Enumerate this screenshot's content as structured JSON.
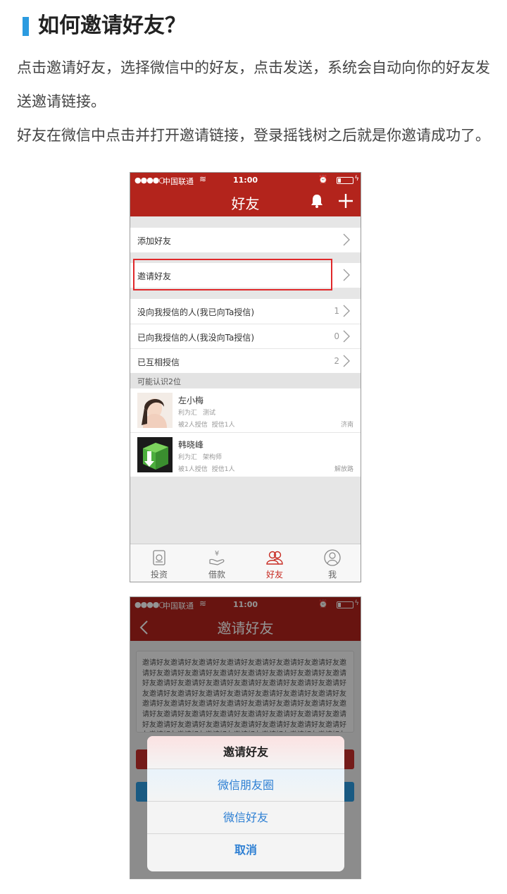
{
  "article": {
    "title": "如何邀请好友？",
    "para1": "点击邀请好友，选择微信中的好友，点击发送，系统会自动向你的好友发送邀请链接。",
    "para2": "好友在微信中点击并打开邀请链接，登录摇钱树之后就是你邀请成功了。"
  },
  "status_bar": {
    "signal": "●●●●○",
    "carrier": "中国联通",
    "time": "11:00"
  },
  "friends_screen": {
    "nav_title": "好友",
    "add_friend": "添加好友",
    "invite_friend": "邀请好友",
    "rows": [
      {
        "label": "没向我授信的人(我已向Ta授信)",
        "count": "1"
      },
      {
        "label": "已向我授信的人(我没向Ta授信)",
        "count": "0"
      },
      {
        "label": "已互相授信",
        "count": "2"
      }
    ],
    "section_header": "可能认识2位",
    "people": [
      {
        "name": "左小梅",
        "company": "利为汇",
        "role": "测试",
        "trusted_by": "被2人授信",
        "trusts": "授信1人",
        "location": "济南"
      },
      {
        "name": "韩晓峰",
        "company": "利为汇",
        "role": "架构师",
        "trusted_by": "被1人授信",
        "trusts": "授信1人",
        "location": "解放路"
      }
    ],
    "tabs": [
      {
        "label": "投资",
        "icon": "invest-icon"
      },
      {
        "label": "借款",
        "icon": "loan-icon"
      },
      {
        "label": "好友",
        "icon": "friends-icon"
      },
      {
        "label": "我",
        "icon": "me-icon"
      }
    ],
    "active_tab": "好友"
  },
  "invite_screen": {
    "nav_title": "邀请好友",
    "placeholder_text": "邀请好友邀请好友邀请好友邀请好友邀请好友邀请好友邀请好友邀请好友邀请好友邀请好友邀请好友邀请好友邀请好友邀请好友邀请好友邀请好友邀请好友邀请好友邀请好友邀请好友邀请好友邀请好友邀请好友邀请好友邀请好友邀请好友邀请好友邀请好友邀请好友邀请好友邀请好友邀请好友邀请好友邀请好友邀请好友邀请好友邀请好友邀请好友邀请好友邀请好友邀请好友邀请好友邀请好友邀请好友邀请好友邀请好友邀请好友邀请好友邀请好友邀请好友邀请好友邀请好友邀请好友邀请好友邀请好友邀请好友邀请好友邀请好友邀请好友邀请好友邀请好友邀请好友邀请好友邀请好友邀请好友邀请好友邀请好友邀请好友邀请好友邀请好友邀请好友",
    "sheet": {
      "title": "邀请好友",
      "moments": "微信朋友圈",
      "wechat_friend": "微信好友",
      "cancel": "取消"
    }
  },
  "colors": {
    "accent_red": "#b3241c",
    "highlight_red": "#e0282a",
    "title_bar_blue": "#2b9be0",
    "link_blue": "#2d7fd3"
  }
}
